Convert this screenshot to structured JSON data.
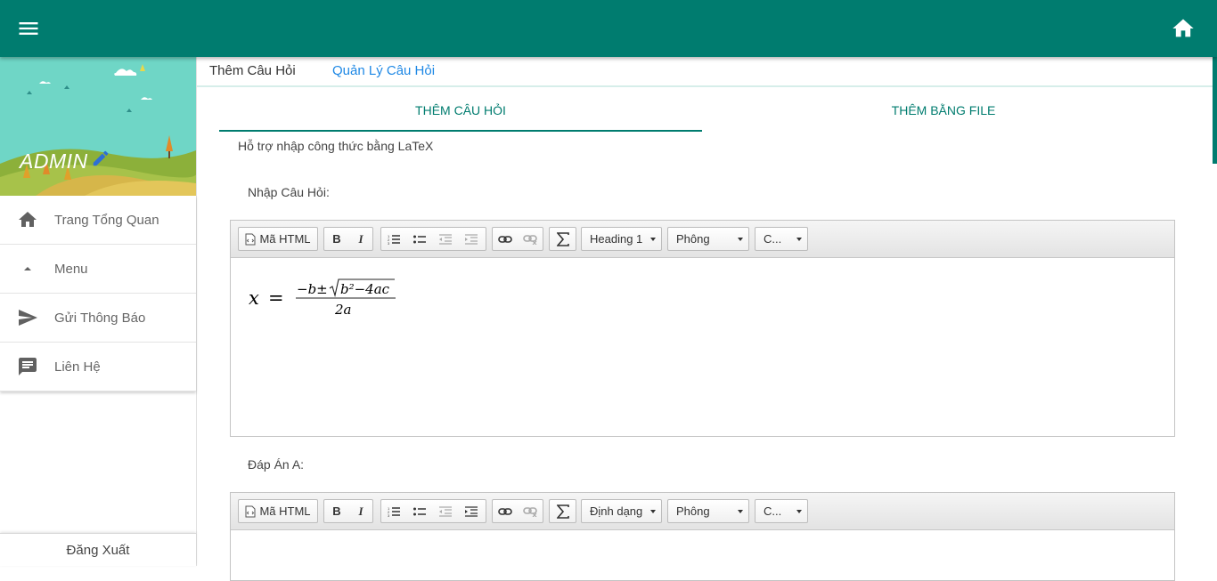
{
  "topbar": {
    "menu_icon": "hamburger-icon",
    "home_icon": "home-icon",
    "color": "#007c6f"
  },
  "sidebar": {
    "user_name": "ADMIN",
    "items": [
      {
        "label": "Trang Tổng Quan",
        "icon": "home-icon"
      },
      {
        "label": "Menu",
        "icon": "caret-up-icon"
      },
      {
        "label": "Gửi Thông Báo",
        "icon": "send-icon"
      },
      {
        "label": "Liên Hệ",
        "icon": "chat-icon"
      }
    ],
    "logout_label": "Đăng Xuất"
  },
  "tabs": [
    {
      "label": "Thêm Câu Hỏi",
      "active": true
    },
    {
      "label": "Quản Lý Câu Hỏi",
      "active": false
    }
  ],
  "subtabs": [
    {
      "label": "THÊM CÂU HỎI",
      "active": true
    },
    {
      "label": "THÊM BẰNG FILE",
      "active": false
    }
  ],
  "latex_note": "Hỗ trợ nhập công thức bằng LaTeX",
  "question_editor": {
    "label": "Nhập Câu Hỏi:",
    "toolbar": {
      "source_label": "Mã HTML",
      "bold_label": "B",
      "italic_label": "I",
      "format_value": "Heading 1",
      "font_value": "Phông",
      "size_value": "C..."
    },
    "formula": {
      "lhs": "x",
      "equals": "=",
      "numerator_prefix": "−b±",
      "radicand": "b²−4ac",
      "denominator": "2a"
    }
  },
  "answer_a_editor": {
    "label": "Đáp Án A:",
    "toolbar": {
      "source_label": "Mã HTML",
      "bold_label": "B",
      "italic_label": "I",
      "format_value": "Định dạng",
      "font_value": "Phông",
      "size_value": "C..."
    }
  }
}
